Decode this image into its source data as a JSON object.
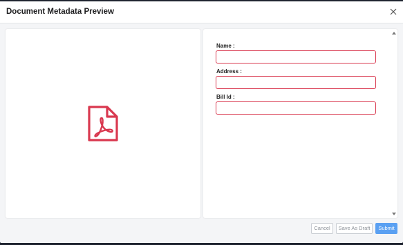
{
  "modal": {
    "title": "Document Metadata Preview",
    "close_icon": "close-icon"
  },
  "preview": {
    "icon": "pdf-file-icon",
    "icon_color": "#d9384f"
  },
  "form": {
    "fields": [
      {
        "label": "Name :",
        "value": "",
        "placeholder": ""
      },
      {
        "label": "Address :",
        "value": "",
        "placeholder": ""
      },
      {
        "label": "Bill Id :",
        "value": "",
        "placeholder": ""
      }
    ],
    "error_border_color": "#d9384f"
  },
  "footer": {
    "cancel_label": "Cancel",
    "draft_label": "Save As Draft",
    "submit_label": "Submit",
    "submit_color": "#5aa0f2"
  }
}
